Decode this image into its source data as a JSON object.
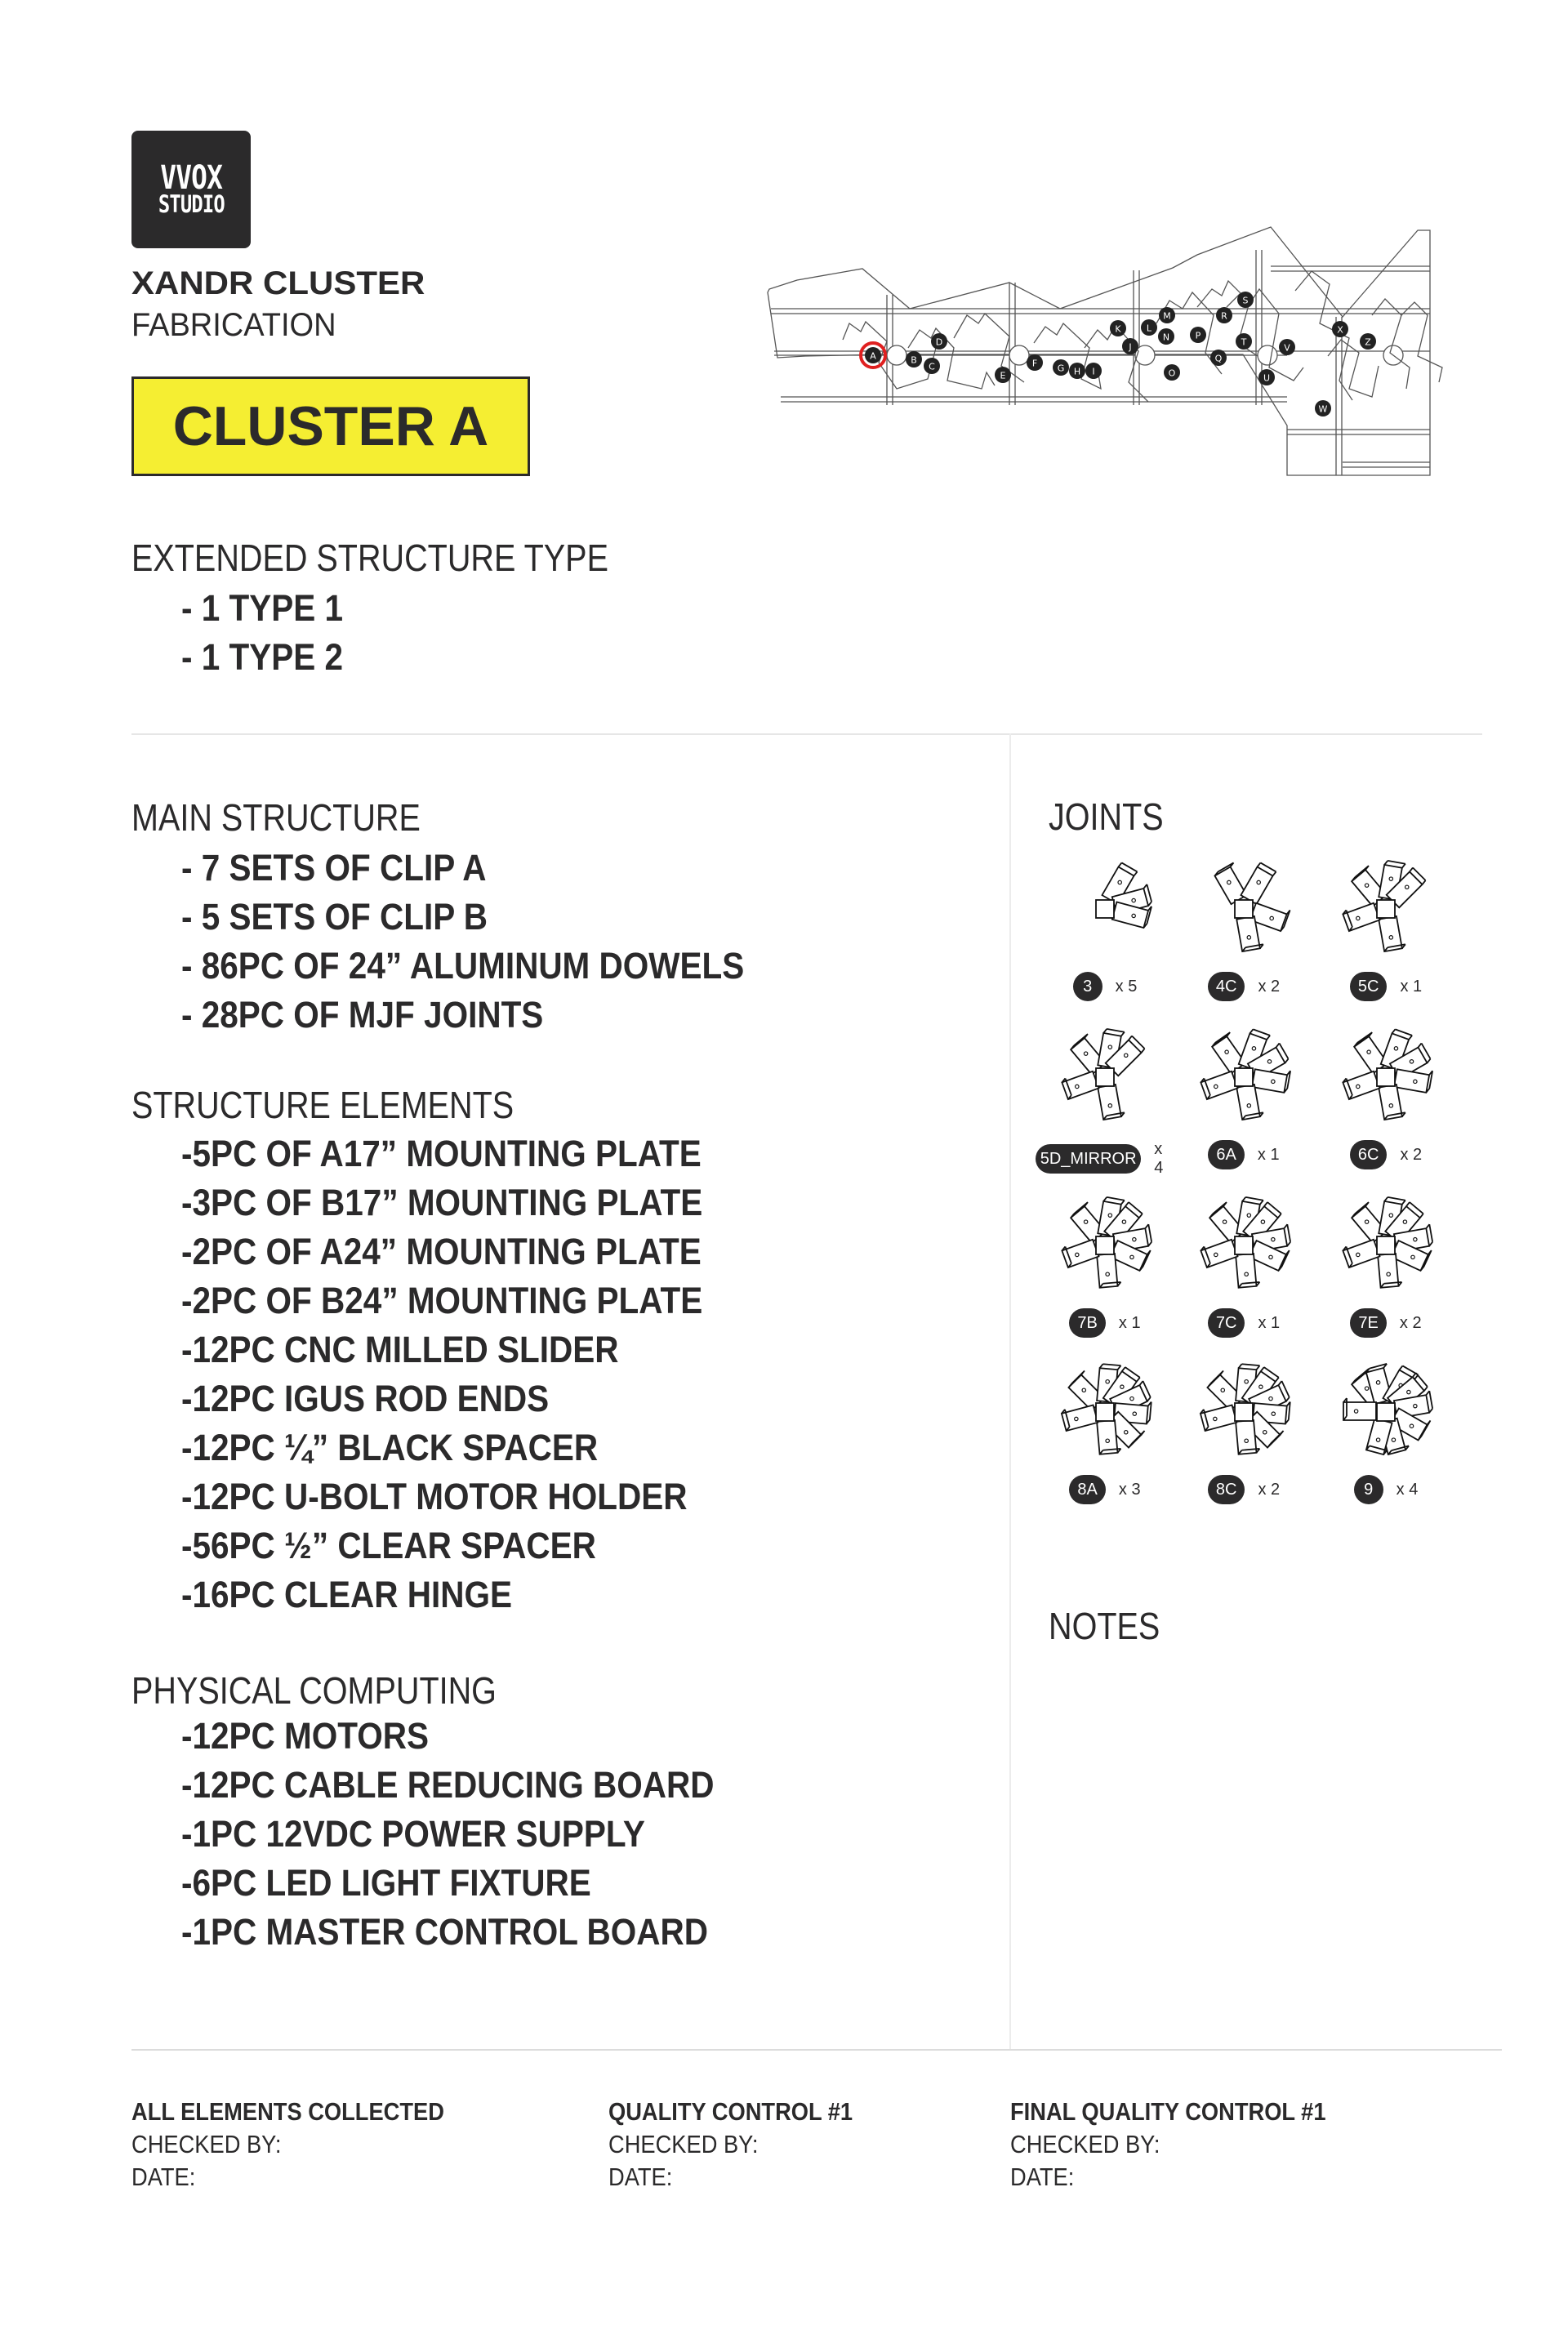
{
  "header": {
    "logo_line1": "VVOX",
    "logo_line2": "STUDIO",
    "project_title": "XANDR CLUSTER",
    "project_subtitle": "FABRICATION",
    "cluster_label": "CLUSTER A",
    "cluster_highlight_color": "#f5ee32"
  },
  "map": {
    "highlighted_cluster": "A",
    "highlight_color": "#e02020",
    "nodes": [
      "A",
      "B",
      "C",
      "D",
      "E",
      "F",
      "G",
      "H",
      "I",
      "J",
      "K",
      "L",
      "M",
      "N",
      "O",
      "P",
      "Q",
      "R",
      "S",
      "T",
      "U",
      "V",
      "W",
      "X",
      "Z"
    ]
  },
  "extended_structure": {
    "heading": "EXTENDED STRUCTURE TYPE",
    "items": [
      "- 1 TYPE 1",
      "- 1 TYPE 2"
    ]
  },
  "main_structure": {
    "heading": "MAIN STRUCTURE",
    "items": [
      "- 7 SETS OF CLIP A",
      "- 5 SETS OF CLIP B",
      "- 86PC OF 24” ALUMINUM DOWELS",
      "- 28PC OF MJF JOINTS"
    ]
  },
  "structure_elements": {
    "heading": "STRUCTURE ELEMENTS",
    "items": [
      "-5PC OF A17” MOUNTING PLATE",
      "-3PC OF B17” MOUNTING PLATE",
      "-2PC OF A24” MOUNTING PLATE",
      "-2PC OF B24” MOUNTING PLATE",
      "-12PC CNC MILLED SLIDER",
      "-12PC IGUS ROD ENDS",
      "-12PC ¼” BLACK SPACER",
      "-12PC U-BOLT MOTOR HOLDER",
      "-56PC ½” CLEAR SPACER",
      "-16PC CLEAR HINGE"
    ]
  },
  "physical_computing": {
    "heading": "PHYSICAL COMPUTING",
    "items": [
      "-12PC MOTORS",
      "-12PC CABLE REDUCING BOARD",
      "-1PC 12VDC POWER SUPPLY",
      "-6PC LED LIGHT FIXTURE",
      "-1PC MASTER CONTROL BOARD"
    ]
  },
  "joints": {
    "heading": "JOINTS",
    "items": [
      {
        "code": "3",
        "qty": "x 5",
        "arms": 3
      },
      {
        "code": "4C",
        "qty": "x 2",
        "arms": 4
      },
      {
        "code": "5C",
        "qty": "x 1",
        "arms": 5
      },
      {
        "code": "5D_MIRROR",
        "qty": "x 4",
        "arms": 5
      },
      {
        "code": "6A",
        "qty": "x 1",
        "arms": 6
      },
      {
        "code": "6C",
        "qty": "x 2",
        "arms": 6
      },
      {
        "code": "7B",
        "qty": "x 1",
        "arms": 7
      },
      {
        "code": "7C",
        "qty": "x 1",
        "arms": 7
      },
      {
        "code": "7E",
        "qty": "x 2",
        "arms": 7
      },
      {
        "code": "8A",
        "qty": "x 3",
        "arms": 8
      },
      {
        "code": "8C",
        "qty": "x 2",
        "arms": 8
      },
      {
        "code": "9",
        "qty": "x 4",
        "arms": 9
      }
    ]
  },
  "notes": {
    "heading": "NOTES"
  },
  "footer": {
    "columns": [
      {
        "title": "ALL ELEMENTS COLLECTED",
        "checked_by": "CHECKED BY:",
        "date": "DATE:"
      },
      {
        "title": "QUALITY CONTROL #1",
        "checked_by": "CHECKED BY:",
        "date": "DATE:"
      },
      {
        "title": "FINAL QUALITY CONTROL #1",
        "checked_by": "CHECKED BY:",
        "date": "DATE:"
      }
    ]
  }
}
